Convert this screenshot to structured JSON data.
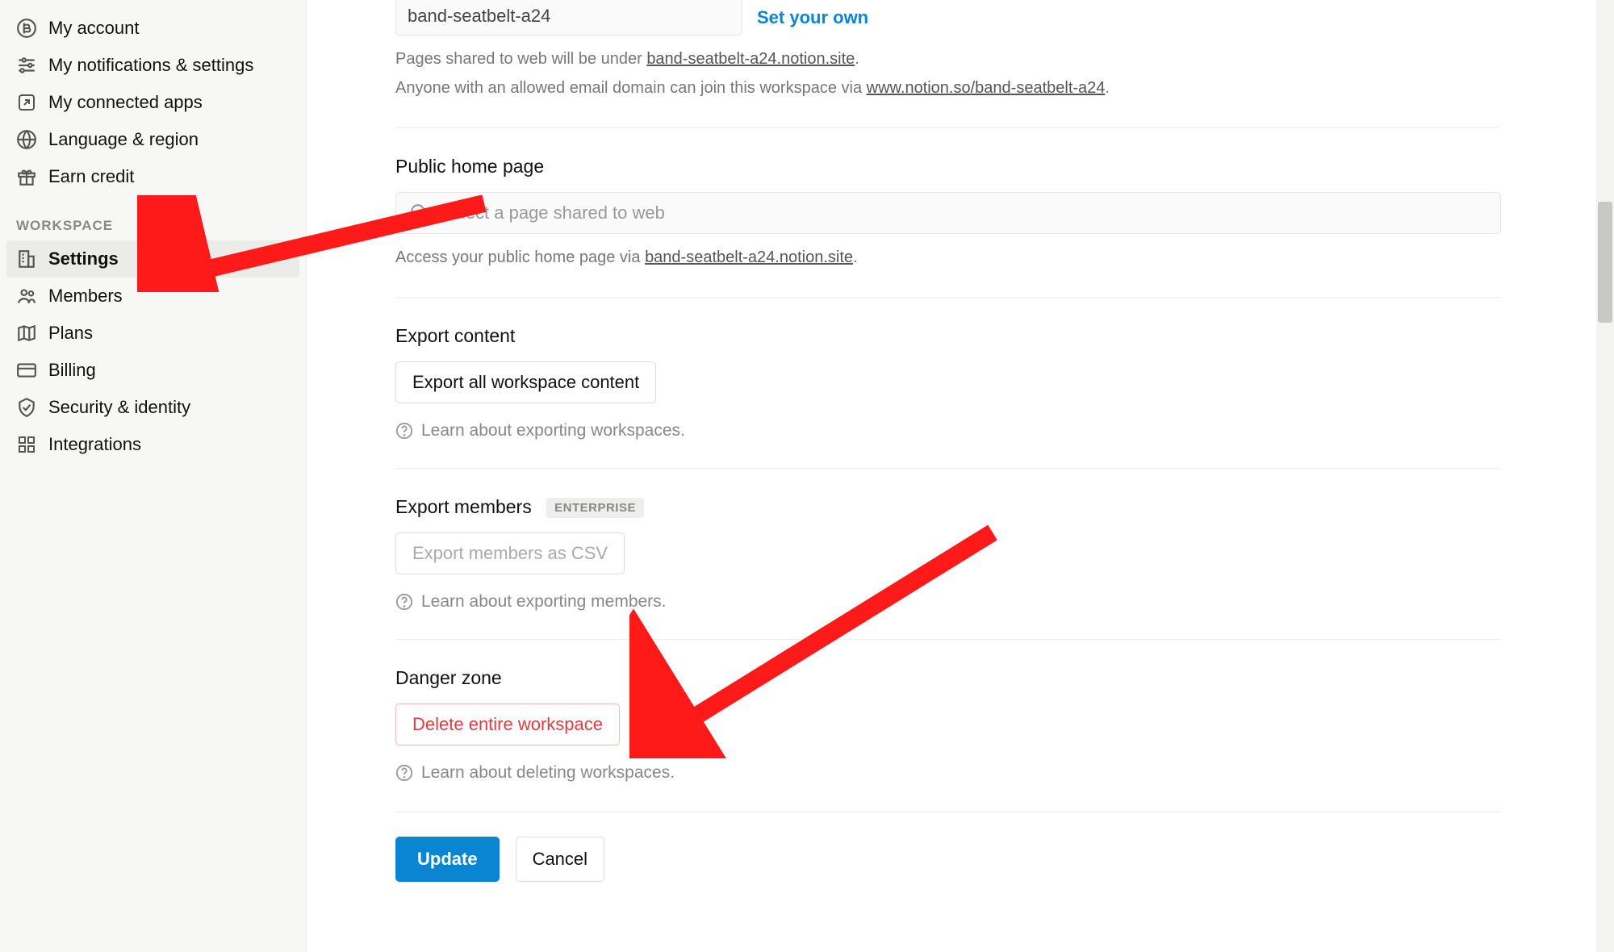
{
  "sidebar": {
    "account_items": [
      {
        "label": "My account"
      },
      {
        "label": "My notifications & settings"
      },
      {
        "label": "My connected apps"
      },
      {
        "label": "Language & region"
      },
      {
        "label": "Earn credit"
      }
    ],
    "section_label": "Workspace",
    "workspace_items": [
      {
        "label": "Settings",
        "active": true
      },
      {
        "label": "Members"
      },
      {
        "label": "Plans"
      },
      {
        "label": "Billing"
      },
      {
        "label": "Security & identity"
      },
      {
        "label": "Integrations"
      }
    ]
  },
  "domain": {
    "value": "band-seatbelt-a24",
    "set_own": "Set your own",
    "desc_prefix": "Pages shared to web will be under ",
    "desc_link1": "band-seatbelt-a24.notion.site",
    "desc2_prefix": "Anyone with an allowed email domain can join this workspace via ",
    "desc_link2": "www.notion.so/band-seatbelt-a24"
  },
  "public_home": {
    "heading": "Public home page",
    "placeholder": "Select a page shared to web",
    "desc_prefix": "Access your public home page via ",
    "desc_link": "band-seatbelt-a24.notion.site"
  },
  "export_content": {
    "heading": "Export content",
    "button": "Export all workspace content",
    "help": "Learn about exporting workspaces."
  },
  "export_members": {
    "heading": "Export members",
    "badge": "ENTERPRISE",
    "button": "Export members as CSV",
    "help": "Learn about exporting members."
  },
  "danger": {
    "heading": "Danger zone",
    "button": "Delete entire workspace",
    "help": "Learn about deleting workspaces."
  },
  "footer": {
    "update": "Update",
    "cancel": "Cancel"
  }
}
